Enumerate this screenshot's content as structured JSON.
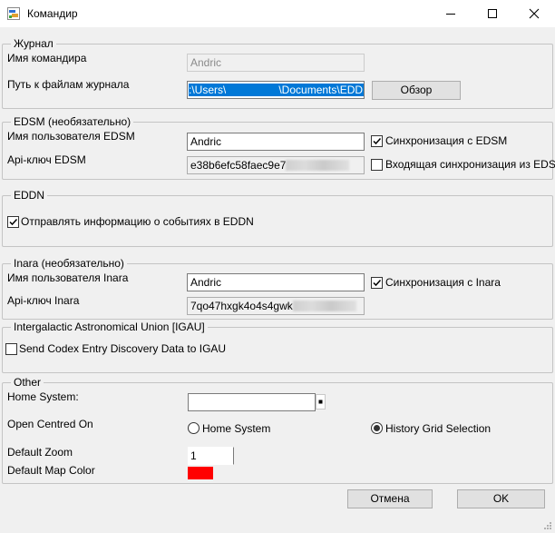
{
  "window": {
    "title": "Командир"
  },
  "journal": {
    "legend": "Журнал",
    "name_label": "Имя командира",
    "name_value": "Andric",
    "path_label": "Путь к файлам журнала",
    "path_value_start": ":\\Users\\",
    "path_value_end": "\\Documents\\EDDB",
    "browse_label": "Обзор"
  },
  "edsm": {
    "legend": "EDSM (необязательно)",
    "user_label": "Имя пользователя EDSM",
    "user_value": "Andric",
    "api_label": "Api-ключ EDSM",
    "api_value": "e38b6efc58faec9e7",
    "sync_label": "Синхронизация с EDSM",
    "sync_checked": true,
    "incoming_label": "Входящая синхронизация из EDSM",
    "incoming_checked": false
  },
  "eddn": {
    "legend": "EDDN",
    "send_label": "Отправлять информацию о событиях в EDDN",
    "send_checked": true
  },
  "inara": {
    "legend": "Inara (необязательно)",
    "user_label": "Имя пользователя Inara",
    "user_value": "Andric",
    "api_label": "Api-ключ Inara",
    "api_value": "7qo47hxgk4o4s4gwk",
    "sync_label": "Синхронизация с Inara",
    "sync_checked": true
  },
  "igau": {
    "legend": "Intergalactic Astronomical Union [IGAU]",
    "send_label": "Send Codex Entry Discovery Data to IGAU",
    "send_checked": false
  },
  "other": {
    "legend": "Other",
    "home_label": "Home System:",
    "home_value": "",
    "open_label": "Open Centred On",
    "radio_home_label": "Home System",
    "radio_grid_label": "History Grid Selection",
    "selected": "History Grid Selection",
    "zoom_label": "Default Zoom",
    "zoom_value": "1",
    "color_label": "Default Map Color",
    "map_color": "#ff0000"
  },
  "footer": {
    "cancel_label": "Отмена",
    "ok_label": "OK"
  }
}
